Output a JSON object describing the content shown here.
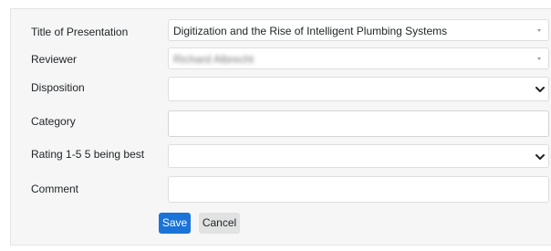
{
  "form": {
    "fields": [
      {
        "label": "Title of Presentation",
        "value": "Digitization and the Rise of Intelligent Plumbing Systems"
      },
      {
        "label": "Reviewer",
        "value": "Richard Albrecht"
      },
      {
        "label": "Disposition",
        "value": ""
      },
      {
        "label": "Category",
        "value": ""
      },
      {
        "label": "Rating 1-5 5 being best",
        "value": ""
      },
      {
        "label": "Comment",
        "value": ""
      }
    ],
    "save_label": "Save",
    "cancel_label": "Cancel"
  },
  "colors": {
    "panel_bg": "#f6f6f6",
    "save_bg": "#1a73d8",
    "cancel_bg": "#e2e2e2"
  }
}
